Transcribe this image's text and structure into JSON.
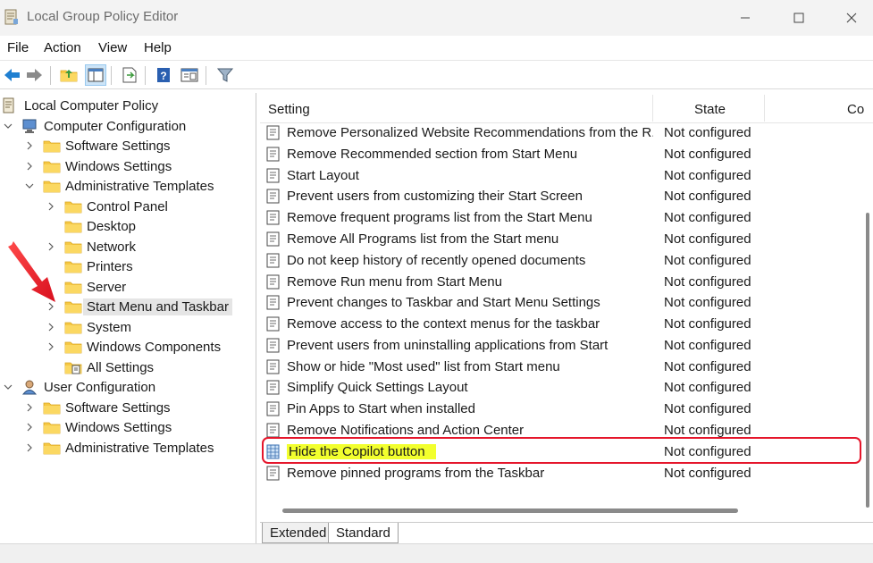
{
  "window": {
    "title": "Local Group Policy Editor",
    "icons": {
      "app": "policy-editor-icon",
      "minimize": "minimize-icon",
      "maximize": "maximize-icon",
      "close": "close-icon"
    }
  },
  "menu": {
    "file": "File",
    "action": "Action",
    "view": "View",
    "help": "Help"
  },
  "toolbar": {
    "buttons": [
      "back-icon",
      "forward-icon",
      "up-folder-icon",
      "show-hide-tree-icon",
      "export-list-icon",
      "help-icon",
      "properties-view-icon",
      "filter-icon"
    ]
  },
  "tree": {
    "root": "Local Computer Policy",
    "computer_config": "Computer Configuration",
    "cc_software": "Software Settings",
    "cc_windows": "Windows Settings",
    "cc_admin": "Administrative Templates",
    "control_panel": "Control Panel",
    "desktop": "Desktop",
    "network": "Network",
    "printers": "Printers",
    "server": "Server",
    "start_menu": "Start Menu and Taskbar",
    "system": "System",
    "windows_components": "Windows Components",
    "all_settings": "All Settings",
    "user_config": "User Configuration",
    "uc_software": "Software Settings",
    "uc_windows": "Windows Settings",
    "uc_admin": "Administrative Templates",
    "selected": "Start Menu and Taskbar"
  },
  "list": {
    "headers": {
      "setting": "Setting",
      "state": "State",
      "comment": "Co"
    },
    "rows": [
      {
        "name": "Remove Personalized Website Recommendations from the R...",
        "state": "Not configured"
      },
      {
        "name": "Remove Recommended section from Start Menu",
        "state": "Not configured"
      },
      {
        "name": "Start Layout",
        "state": "Not configured"
      },
      {
        "name": "Prevent users from customizing their Start Screen",
        "state": "Not configured"
      },
      {
        "name": "Remove frequent programs list from the Start Menu",
        "state": "Not configured"
      },
      {
        "name": "Remove All Programs list from the Start menu",
        "state": "Not configured"
      },
      {
        "name": "Do not keep history of recently opened documents",
        "state": "Not configured"
      },
      {
        "name": "Remove Run menu from Start Menu",
        "state": "Not configured"
      },
      {
        "name": "Prevent changes to Taskbar and Start Menu Settings",
        "state": "Not configured"
      },
      {
        "name": "Remove access to the context menus for the taskbar",
        "state": "Not configured"
      },
      {
        "name": "Prevent users from uninstalling applications from Start",
        "state": "Not configured"
      },
      {
        "name": "Show or hide \"Most used\" list from Start menu",
        "state": "Not configured"
      },
      {
        "name": "Simplify Quick Settings Layout",
        "state": "Not configured"
      },
      {
        "name": "Pin Apps to Start when installed",
        "state": "Not configured"
      },
      {
        "name": "Remove Notifications and Action Center",
        "state": "Not configured"
      },
      {
        "name": "Hide the Copilot button",
        "state": "Not configured"
      },
      {
        "name": "Remove pinned programs from the Taskbar",
        "state": "Not configured"
      }
    ],
    "highlighted_row": "Hide the Copilot button"
  },
  "tabs": {
    "extended": "Extended",
    "standard": "Standard",
    "active": "Standard"
  },
  "colors": {
    "highlight": "#f2ff2e",
    "callout": "#e5162b",
    "folder": "#f6c844"
  }
}
